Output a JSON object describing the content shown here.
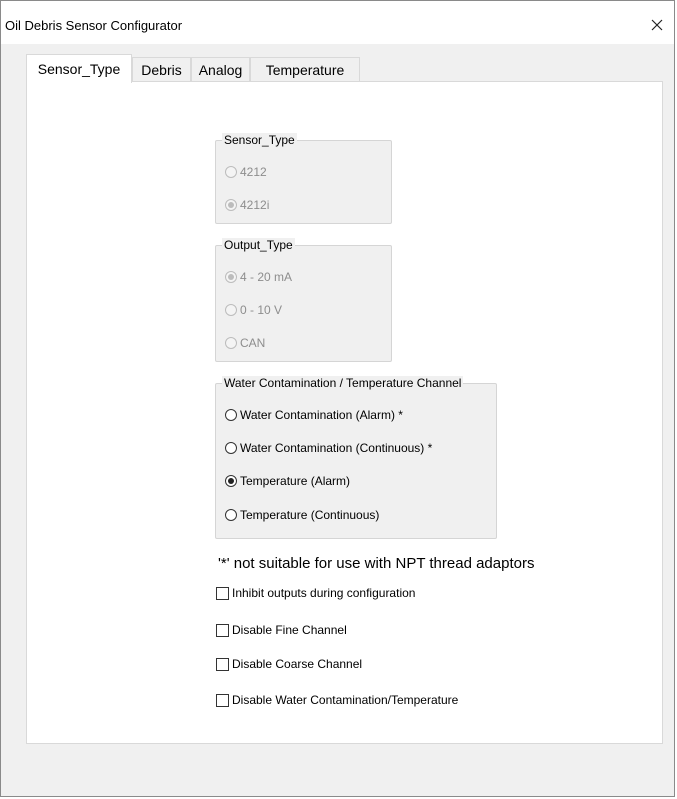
{
  "window": {
    "title": "Oil Debris Sensor Configurator"
  },
  "tabs": [
    {
      "label": "Sensor_Type",
      "active": true
    },
    {
      "label": "Debris",
      "active": false
    },
    {
      "label": "Analog",
      "active": false
    },
    {
      "label": "Temperature",
      "active": false
    }
  ],
  "sensor_type": {
    "legend": "Sensor_Type",
    "enabled": false,
    "options": [
      {
        "label": "4212",
        "checked": false
      },
      {
        "label": "4212i",
        "checked": true
      }
    ]
  },
  "output_type": {
    "legend": "Output_Type",
    "enabled": false,
    "options": [
      {
        "label": "4 - 20 mA",
        "checked": true
      },
      {
        "label": "0 - 10 V",
        "checked": false
      },
      {
        "label": "CAN",
        "checked": false
      }
    ]
  },
  "water_channel": {
    "legend": "Water Contamination / Temperature Channel",
    "enabled": true,
    "options": [
      {
        "label": "Water Contamination (Alarm) *",
        "checked": false
      },
      {
        "label": "Water Contamination (Continuous) *",
        "checked": false
      },
      {
        "label": "Temperature (Alarm)",
        "checked": true
      },
      {
        "label": "Temperature (Continuous)",
        "checked": false
      }
    ]
  },
  "note": "'*' not suitable for use with NPT thread adaptors",
  "checkboxes": [
    {
      "label": "Inhibit outputs during configuration",
      "checked": false
    },
    {
      "label": "Disable Fine Channel",
      "checked": false
    },
    {
      "label": "Disable Coarse Channel",
      "checked": false
    },
    {
      "label": "Disable Water Contamination/Temperature",
      "checked": false
    }
  ]
}
